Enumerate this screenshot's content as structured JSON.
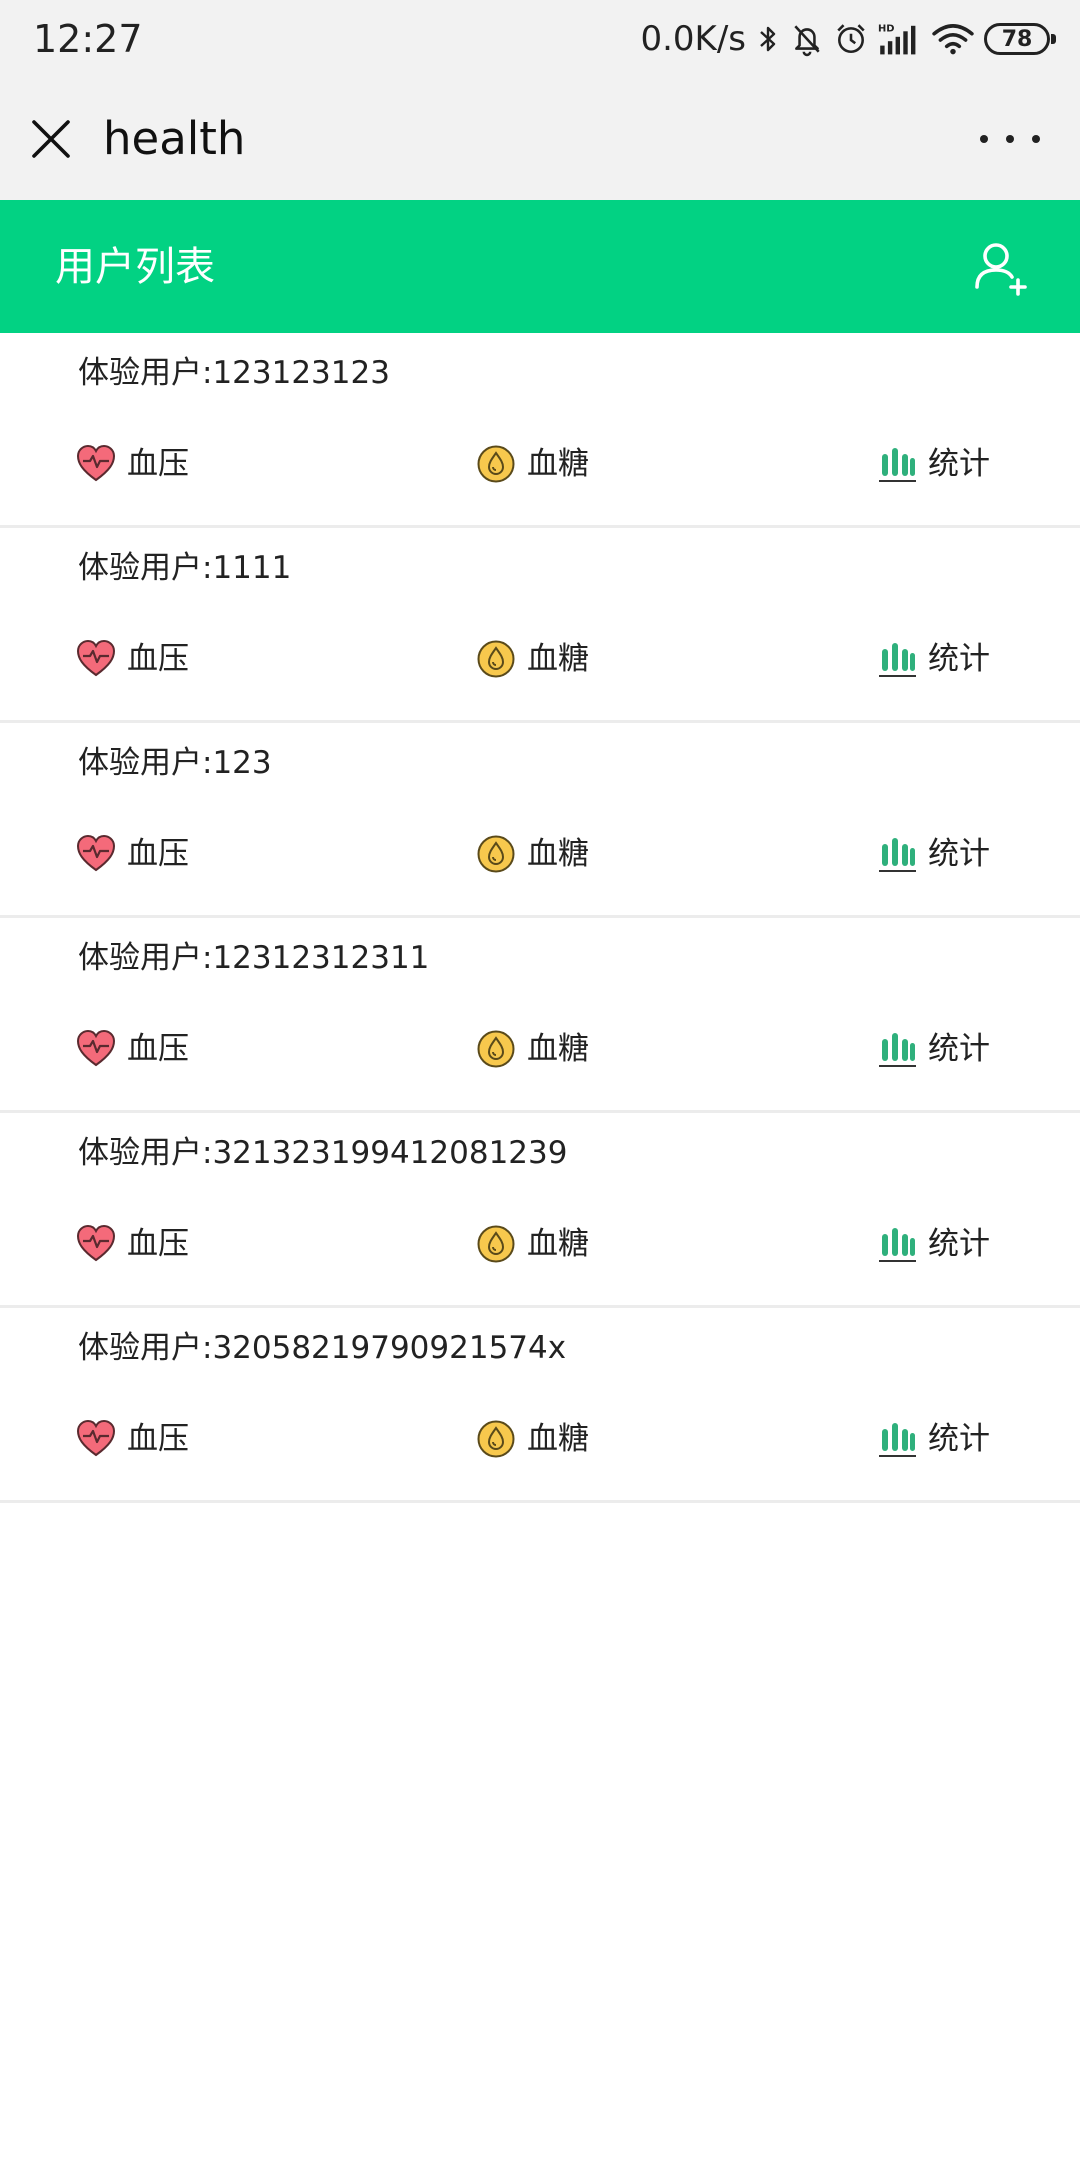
{
  "status_bar": {
    "time": "12:27",
    "net_speed": "0.0K/s",
    "battery": "78",
    "icons": [
      "bluetooth-icon",
      "mute-bell-icon",
      "alarm-icon",
      "hd-signal-icon",
      "wifi-icon",
      "battery-icon"
    ]
  },
  "title_bar": {
    "title": "health"
  },
  "header": {
    "title": "用户列表",
    "accent_color": "#02d283"
  },
  "users": [
    {
      "name": "体验用户:123123123"
    },
    {
      "name": "体验用户:1111"
    },
    {
      "name": "体验用户:123"
    },
    {
      "name": "体验用户:12312312311"
    },
    {
      "name": "体验用户:321323199412081239"
    },
    {
      "name": "体验用户:32058219790921574x"
    }
  ],
  "actions": {
    "blood_pressure": "血压",
    "blood_sugar": "血糖",
    "stats": "统计"
  },
  "colors": {
    "heart": "#f46a7a",
    "drop": "#f7c84d",
    "chart": "#2fb07c"
  }
}
